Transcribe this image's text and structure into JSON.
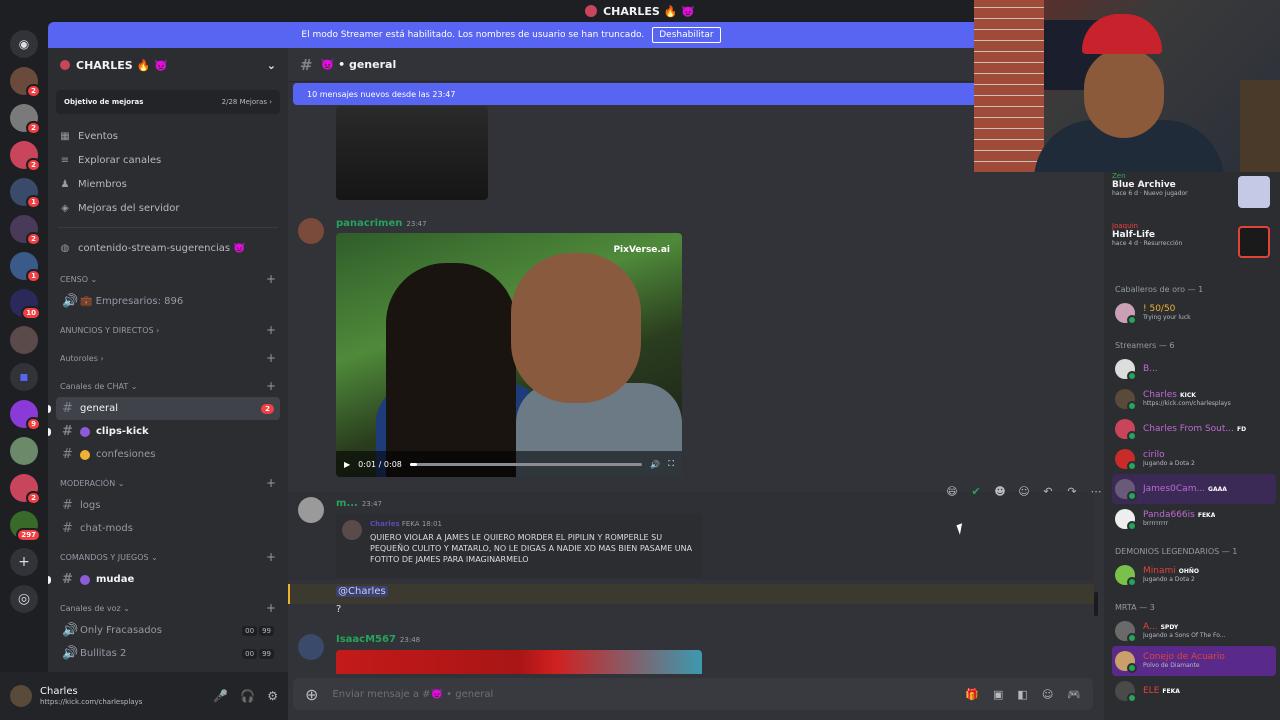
{
  "titlebar": {
    "title": "CHARLES 🔥 👿"
  },
  "banner": {
    "text": "El modo Streamer está habilitado. Los nombres de usuario se han truncado.",
    "button": "Deshabilitar"
  },
  "rail": {
    "badges": [
      "2",
      "2",
      "2",
      "1",
      "2",
      "1",
      "10",
      "9",
      "2",
      "297"
    ]
  },
  "server": {
    "name": "CHARLES 🔥 👿",
    "goal_label": "Objetivo de mejoras",
    "goal_progress": "2/28 Mejoras ›",
    "nav": [
      "Eventos",
      "Explorar canales",
      "Miembros",
      "Mejoras del servidor"
    ],
    "pinned_channel": "contenido-stream-sugerencias 👿",
    "categories": {
      "censo": "CENSO ⌄",
      "empresarios": "💼 Empresarios: 896",
      "anuncios": "ANUNCIOS Y DIRECTOS ›",
      "autoroles": "Autoroles ›",
      "chat": "Canales de CHAT ⌄",
      "moderacion": "MODERACIÓN ⌄",
      "comandos": "COMANDOS Y JUEGOS ⌄",
      "voz": "Canales de voz ⌄"
    },
    "channels": {
      "general": "general",
      "general_badge": "2",
      "clips": "clips-kick",
      "confesiones": "confesiones",
      "logs": "logs",
      "chatmods": "chat-mods",
      "mudae": "mudae",
      "voice1": "Only Fracasados",
      "voice2": "Bullitas 2",
      "vc_a": "00",
      "vc_b": "99"
    }
  },
  "user": {
    "name": "Charles",
    "status": "https://kick.com/charlesplays"
  },
  "chat": {
    "channel": "👿 • general",
    "new_messages": "10 mensajes nuevos desde las 23:47",
    "msg1": {
      "author": "panacrimen",
      "time": "23:47",
      "watermark": "PixVerse.ai",
      "video_time": "0:01 / 0:08",
      "progress": 0.03
    },
    "msg2": {
      "author": "m...",
      "time": "23:47",
      "reply_author": "Charles",
      "reply_tag": "FEKA",
      "reply_time": "18:01",
      "reply_text": "QUIERO VIOLAR A JAMES LE QUIERO MORDER EL PIPILIN Y ROMPERLE SU PEQUEÑO CULITO Y MATARLO, NO LE DIGAS A NADIE XD MAS BIEN PASAME UNA FOTITO DE JAMES PARA IMAGINARMELO",
      "mention": "@Charles",
      "text": "?"
    },
    "msg3": {
      "author": "IsaacM567",
      "time": "23:48"
    },
    "composer_placeholder": "Enviar mensaje a #👿 • general"
  },
  "members": {
    "activities": [
      {
        "name": "Zen",
        "title": "Blue Archive",
        "sub": "hace 6 d · Nuevo jugador"
      },
      {
        "name": "Joaquin",
        "title": "Half-Life",
        "sub": "hace 4 d · Resurrección"
      }
    ],
    "groups": [
      {
        "label": "Caballeros de oro — 1",
        "items": [
          {
            "name": "! 50/50",
            "sub": "Trying your luck",
            "color": "#f0b232",
            "tag": ""
          }
        ]
      },
      {
        "label": "Streamers — 6",
        "items": [
          {
            "name": "B...",
            "sub": "",
            "color": "#c069d6",
            "tag": ""
          },
          {
            "name": "Charles",
            "sub": "https://kick.com/charlesplays",
            "color": "#c069d6",
            "tag": "KICK"
          },
          {
            "name": "Charles From Sout...",
            "sub": "",
            "color": "#c069d6",
            "tag": "FD"
          },
          {
            "name": "cirilo",
            "sub": "Jugando a Dota 2",
            "color": "#c069d6",
            "tag": ""
          },
          {
            "name": "James0Cam...",
            "sub": "",
            "color": "#c069d6",
            "tag": "GAAA"
          },
          {
            "name": "Panda666is",
            "sub": "brrrrrrrrr",
            "color": "#c069d6",
            "tag": "FEKA"
          }
        ]
      },
      {
        "label": "DEMONIOS LEGENDARIOS — 1",
        "items": [
          {
            "name": "Minami",
            "sub": "Jugando a Dota 2",
            "color": "#e0433a",
            "tag": "OHÑO"
          }
        ]
      },
      {
        "label": "MRTA — 3",
        "items": [
          {
            "name": "A...",
            "sub": "Jugando a Sons Of The Fo...",
            "color": "#e0433a",
            "tag": "SPDY"
          },
          {
            "name": "Conejo de Acuario",
            "sub": "Polvo de Diamante",
            "color": "#e0433a",
            "tag": ""
          },
          {
            "name": "ELE",
            "sub": "",
            "color": "#e0433a",
            "tag": "FEKA"
          }
        ]
      }
    ]
  }
}
